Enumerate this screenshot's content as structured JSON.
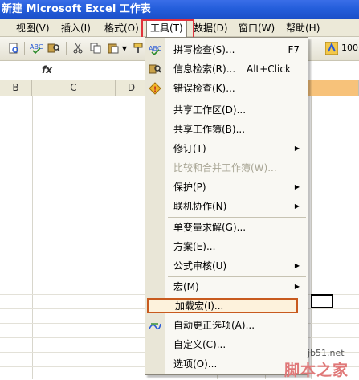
{
  "window": {
    "title": "新建 Microsoft Excel 工作表"
  },
  "menubar": {
    "items": [
      {
        "label": "视图(V)"
      },
      {
        "label": "插入(I)"
      },
      {
        "label": "格式(O)"
      },
      {
        "label": "工具(T)"
      },
      {
        "label": "数据(D)"
      },
      {
        "label": "窗口(W)"
      },
      {
        "label": "帮助(H)"
      }
    ]
  },
  "toolbar": {
    "zoom": "100"
  },
  "formula": {
    "fx": "fx"
  },
  "sheet": {
    "columns": [
      "B",
      "C",
      "D"
    ]
  },
  "tools_menu": {
    "items": [
      {
        "label": "拼写检查(S)...",
        "shortcut": "F7",
        "icon": "spellcheck-icon"
      },
      {
        "label": "信息检索(R)...",
        "shortcut": "Alt+Click",
        "icon": "research-icon"
      },
      {
        "label": "错误检查(K)...",
        "icon": "error-check-icon"
      },
      {
        "label": "共享工作区(D)..."
      },
      {
        "label": "共享工作簿(B)..."
      },
      {
        "label": "修订(T)",
        "submenu": true
      },
      {
        "label": "比较和合并工作簿(W)...",
        "disabled": true
      },
      {
        "label": "保护(P)",
        "submenu": true
      },
      {
        "label": "联机协作(N)",
        "submenu": true
      },
      {
        "label": "单变量求解(G)..."
      },
      {
        "label": "方案(E)..."
      },
      {
        "label": "公式审核(U)",
        "submenu": true
      },
      {
        "label": "宏(M)",
        "submenu": true
      },
      {
        "label": "加载宏(I)...",
        "highlighted": true
      },
      {
        "label": "自动更正选项(A)...",
        "icon": "autocorrect-icon"
      },
      {
        "label": "自定义(C)..."
      },
      {
        "label": "选项(O)..."
      }
    ]
  },
  "watermark": {
    "site": "jb51.net",
    "brand": "脚本之家"
  },
  "colors": {
    "highlight_border": "#c85a1e",
    "red_box": "#e0323c"
  }
}
